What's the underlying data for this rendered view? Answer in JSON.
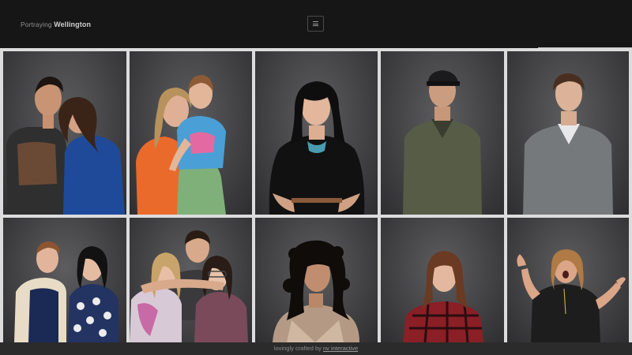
{
  "header": {
    "brand_prefix": "Portraying",
    "brand_name": "Wellington",
    "menu_icon": "hamburger-icon"
  },
  "gallery": {
    "portraits": [
      {
        "id": "portrait-1"
      },
      {
        "id": "portrait-2"
      },
      {
        "id": "portrait-3"
      },
      {
        "id": "portrait-4"
      },
      {
        "id": "portrait-5"
      },
      {
        "id": "portrait-6"
      },
      {
        "id": "portrait-7"
      },
      {
        "id": "portrait-8"
      },
      {
        "id": "portrait-9"
      },
      {
        "id": "portrait-10"
      }
    ]
  },
  "footer": {
    "prefix": "lovingly crafted by",
    "link_text": "nv interactive"
  },
  "colors": {
    "background": "#151515",
    "grid_gap": "#dcdcdc",
    "footer_bg": "#2b2b2b"
  }
}
